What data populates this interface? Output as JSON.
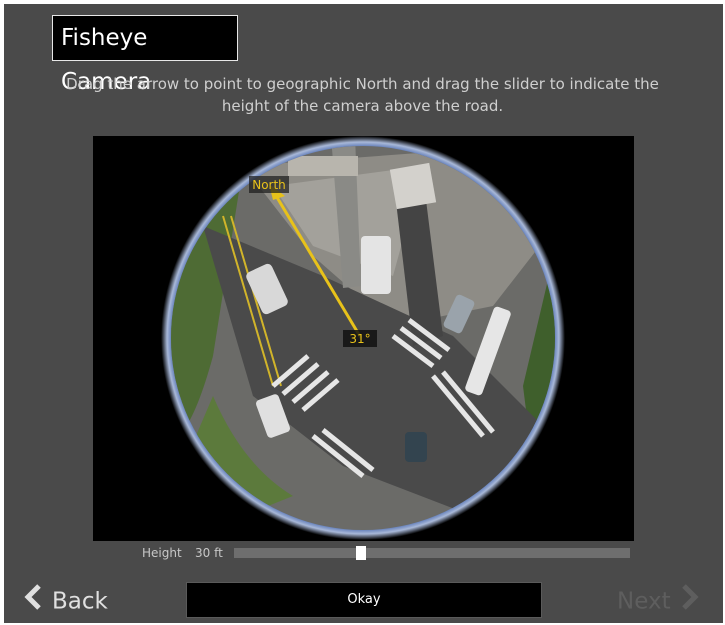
{
  "dialog": {
    "title": "Fisheye Camera",
    "instructions": "Drag the arrow to point to geographic North and drag the slider to indicate the height of the camera above the road."
  },
  "camera_view": {
    "north_label": "North",
    "angle_label": "31°"
  },
  "height": {
    "label": "Height",
    "value_text": "30 ft",
    "slider_fraction": 0.32
  },
  "nav": {
    "back_label": "Back",
    "okay_label": "Okay",
    "next_label": "Next",
    "next_enabled": false
  },
  "colors": {
    "background": "#4a4a4a",
    "arrow": "#e8c21a",
    "slider_thumb": "#ffffff"
  },
  "icons": {
    "back": "chevron-left-icon",
    "next": "chevron-right-icon"
  }
}
